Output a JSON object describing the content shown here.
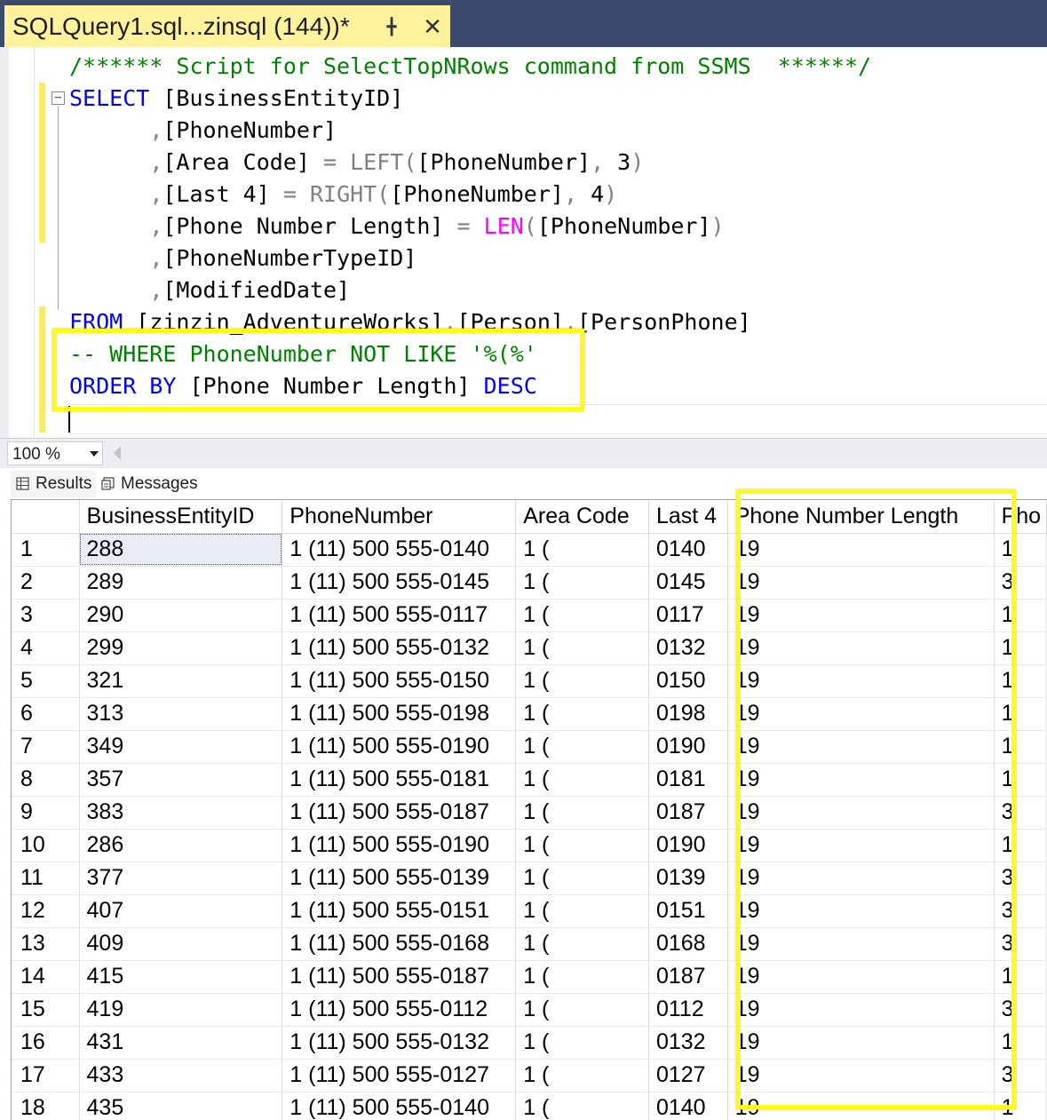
{
  "tab": {
    "title": "SQLQuery1.sql...zinsql (144))*",
    "pin_icon": "pin-icon",
    "close_icon": "close-icon"
  },
  "editor": {
    "lines": [
      "/****** Script for SelectTopNRows command from SSMS  ******/",
      "SELECT [BusinessEntityID]",
      "      ,[PhoneNumber]",
      "      ,[Area Code] = LEFT([PhoneNumber], 3)",
      "      ,[Last 4] = RIGHT([PhoneNumber], 4)",
      "      ,[Phone Number Length] = LEN([PhoneNumber])",
      "      ,[PhoneNumberTypeID]",
      "      ,[ModifiedDate]",
      "FROM [zinzin_AdventureWorks].[Person].[PersonPhone]",
      "-- WHERE PhoneNumber NOT LIKE '%(%'",
      "ORDER BY [Phone Number Length] DESC"
    ]
  },
  "zoom": {
    "value": "100 %"
  },
  "result_tabs": {
    "results": "Results",
    "messages": "Messages"
  },
  "grid": {
    "columns": [
      "",
      "BusinessEntityID",
      "PhoneNumber",
      "Area Code",
      "Last 4",
      "Phone Number Length",
      "Pho"
    ],
    "rows": [
      [
        "1",
        "288",
        "1 (11) 500 555-0140",
        "1 (",
        "0140",
        "19",
        "1"
      ],
      [
        "2",
        "289",
        "1 (11) 500 555-0145",
        "1 (",
        "0145",
        "19",
        "3"
      ],
      [
        "3",
        "290",
        "1 (11) 500 555-0117",
        "1 (",
        "0117",
        "19",
        "1"
      ],
      [
        "4",
        "299",
        "1 (11) 500 555-0132",
        "1 (",
        "0132",
        "19",
        "1"
      ],
      [
        "5",
        "321",
        "1 (11) 500 555-0150",
        "1 (",
        "0150",
        "19",
        "1"
      ],
      [
        "6",
        "313",
        "1 (11) 500 555-0198",
        "1 (",
        "0198",
        "19",
        "1"
      ],
      [
        "7",
        "349",
        "1 (11) 500 555-0190",
        "1 (",
        "0190",
        "19",
        "1"
      ],
      [
        "8",
        "357",
        "1 (11) 500 555-0181",
        "1 (",
        "0181",
        "19",
        "1"
      ],
      [
        "9",
        "383",
        "1 (11) 500 555-0187",
        "1 (",
        "0187",
        "19",
        "3"
      ],
      [
        "10",
        "286",
        "1 (11) 500 555-0190",
        "1 (",
        "0190",
        "19",
        "1"
      ],
      [
        "11",
        "377",
        "1 (11) 500 555-0139",
        "1 (",
        "0139",
        "19",
        "3"
      ],
      [
        "12",
        "407",
        "1 (11) 500 555-0151",
        "1 (",
        "0151",
        "19",
        "3"
      ],
      [
        "13",
        "409",
        "1 (11) 500 555-0168",
        "1 (",
        "0168",
        "19",
        "3"
      ],
      [
        "14",
        "415",
        "1 (11) 500 555-0187",
        "1 (",
        "0187",
        "19",
        "1"
      ],
      [
        "15",
        "419",
        "1 (11) 500 555-0112",
        "1 (",
        "0112",
        "19",
        "3"
      ],
      [
        "16",
        "431",
        "1 (11) 500 555-0132",
        "1 (",
        "0132",
        "19",
        "1"
      ],
      [
        "17",
        "433",
        "1 (11) 500 555-0127",
        "1 (",
        "0127",
        "19",
        "3"
      ],
      [
        "18",
        "435",
        "1 (11) 500 555-0140",
        "1 (",
        "0140",
        "19",
        "1"
      ]
    ]
  },
  "colors": {
    "highlight": "#fffa1c",
    "tab_active": "#fff29d",
    "titlebar": "#3c4a6b"
  }
}
